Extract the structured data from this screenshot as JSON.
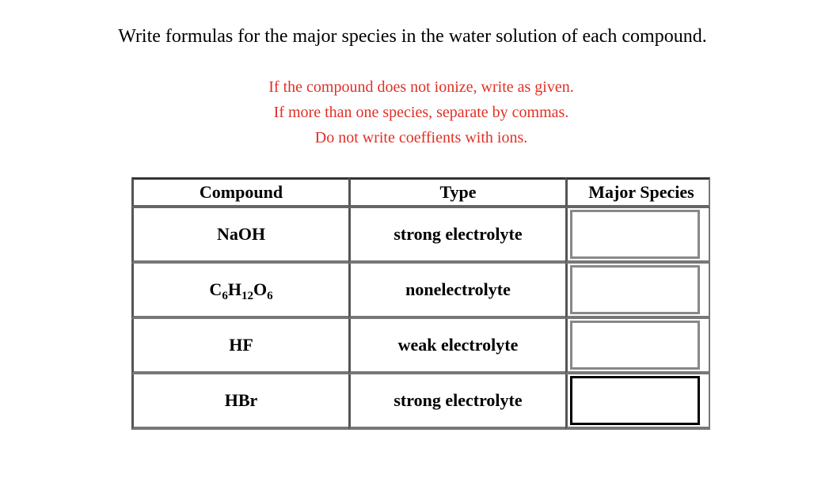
{
  "title": "Write formulas for the major species in the water solution of each compound.",
  "instructions": [
    "If the compound does not ionize, write as given.",
    "If more than one species, separate by commas.",
    "Do not write coeffients with ions."
  ],
  "colors": {
    "instruction_text": "#e03026"
  },
  "table": {
    "headers": [
      "Compound",
      "Type",
      "Major Species"
    ],
    "rows": [
      {
        "compound": "NaOH",
        "type": "strong electrolyte",
        "answer": ""
      },
      {
        "compound_parts": [
          "C",
          "6",
          "H",
          "12",
          "O",
          "6"
        ],
        "type": "nonelectrolyte",
        "answer": ""
      },
      {
        "compound": "HF",
        "type": "weak electrolyte",
        "answer": ""
      },
      {
        "compound": "HBr",
        "type": "strong electrolyte",
        "answer": ""
      }
    ]
  }
}
